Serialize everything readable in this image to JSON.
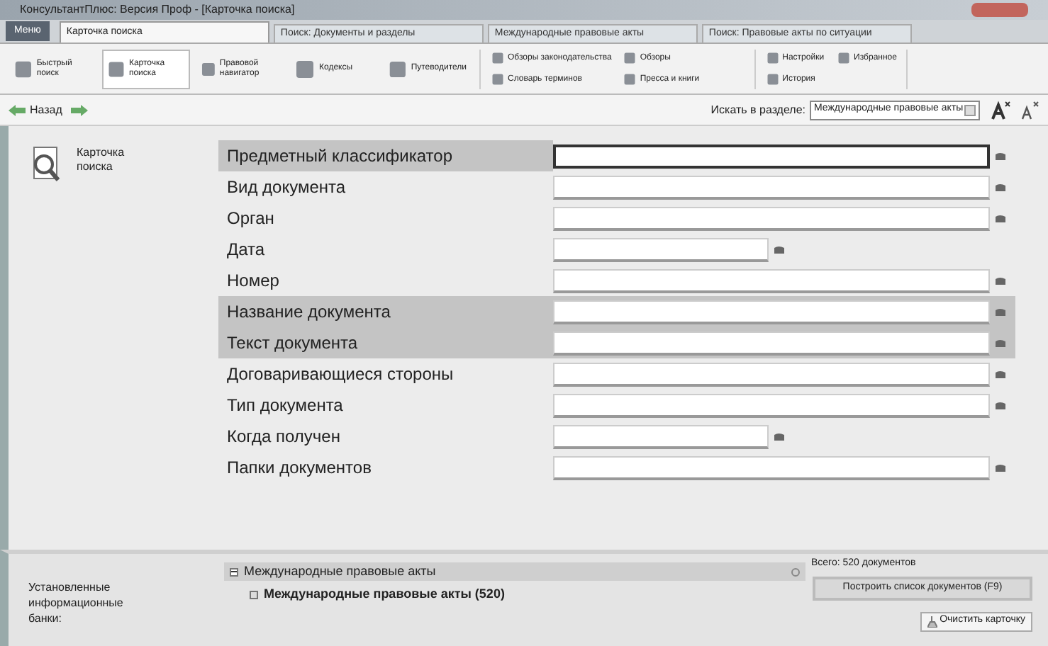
{
  "window": {
    "title": "КонсультантПлюс: Версия Проф - [Карточка поиска]"
  },
  "menu_button": "Меню",
  "tabs": [
    {
      "label": "Карточка поиска",
      "selected": true
    },
    {
      "label": "Поиск: Документы и разделы",
      "selected": false
    },
    {
      "label": "Международные правовые акты",
      "selected": false
    },
    {
      "label": "Поиск: Правовые акты по ситуации",
      "selected": false
    }
  ],
  "toolbar": {
    "groups": [
      [
        {
          "label": "Быстрый поиск",
          "selected": false
        },
        {
          "label": "Карточка поиска",
          "selected": true
        },
        {
          "label": "Правовой навигатор",
          "selected": false
        },
        {
          "label": "Кодексы",
          "selected": false
        },
        {
          "label": "Путеводители",
          "selected": false
        }
      ],
      [
        {
          "label": "Обзоры законодательства",
          "selected": false
        },
        {
          "label": "Обзоры",
          "selected": false
        },
        {
          "label": "Словарь терминов",
          "selected": false
        },
        {
          "label": "Пресса и книги",
          "selected": false
        }
      ],
      [
        {
          "label": "Настройки",
          "selected": false
        },
        {
          "label": "Избранное",
          "selected": false
        },
        {
          "label": "История",
          "selected": false
        }
      ]
    ]
  },
  "nav": {
    "back": "Назад",
    "search_in_label": "Искать в разделе:",
    "search_in_value": "Международные правовые акты"
  },
  "card": {
    "title": "Карточка поиска"
  },
  "fields": [
    {
      "label": "Предметный классификатор",
      "kind": "full",
      "highlighted": true,
      "focused": true
    },
    {
      "label": "Вид документа",
      "kind": "full",
      "highlighted": false,
      "focused": false
    },
    {
      "label": "Орган",
      "kind": "full",
      "highlighted": false,
      "focused": false
    },
    {
      "label": "Дата",
      "kind": "short",
      "highlighted": false,
      "focused": false
    },
    {
      "label": "Номер",
      "kind": "full",
      "highlighted": false,
      "focused": false
    },
    {
      "label": "Название документа",
      "kind": "full",
      "highlighted": true,
      "focused": false
    },
    {
      "label": "Текст документа",
      "kind": "full",
      "highlighted": true,
      "focused": false
    },
    {
      "label": "Договаривающиеся стороны",
      "kind": "full",
      "highlighted": false,
      "focused": false
    },
    {
      "label": "Тип документа",
      "kind": "full",
      "highlighted": false,
      "focused": false
    },
    {
      "label": "Когда получен",
      "kind": "short",
      "highlighted": false,
      "focused": false
    },
    {
      "label": "Папки документов",
      "kind": "full",
      "highlighted": false,
      "focused": false
    }
  ],
  "bottom": {
    "banks_label": "Установленные информационные банки:",
    "banks": [
      {
        "label": "Международные правовые акты",
        "expanded": true,
        "children": [
          {
            "label": "Международные правовые акты (520)",
            "checked": false
          }
        ]
      }
    ],
    "total": "Всего: 520 документов",
    "build_button": "Построить список документов (F9)",
    "clear_button": "Очистить карточку"
  }
}
